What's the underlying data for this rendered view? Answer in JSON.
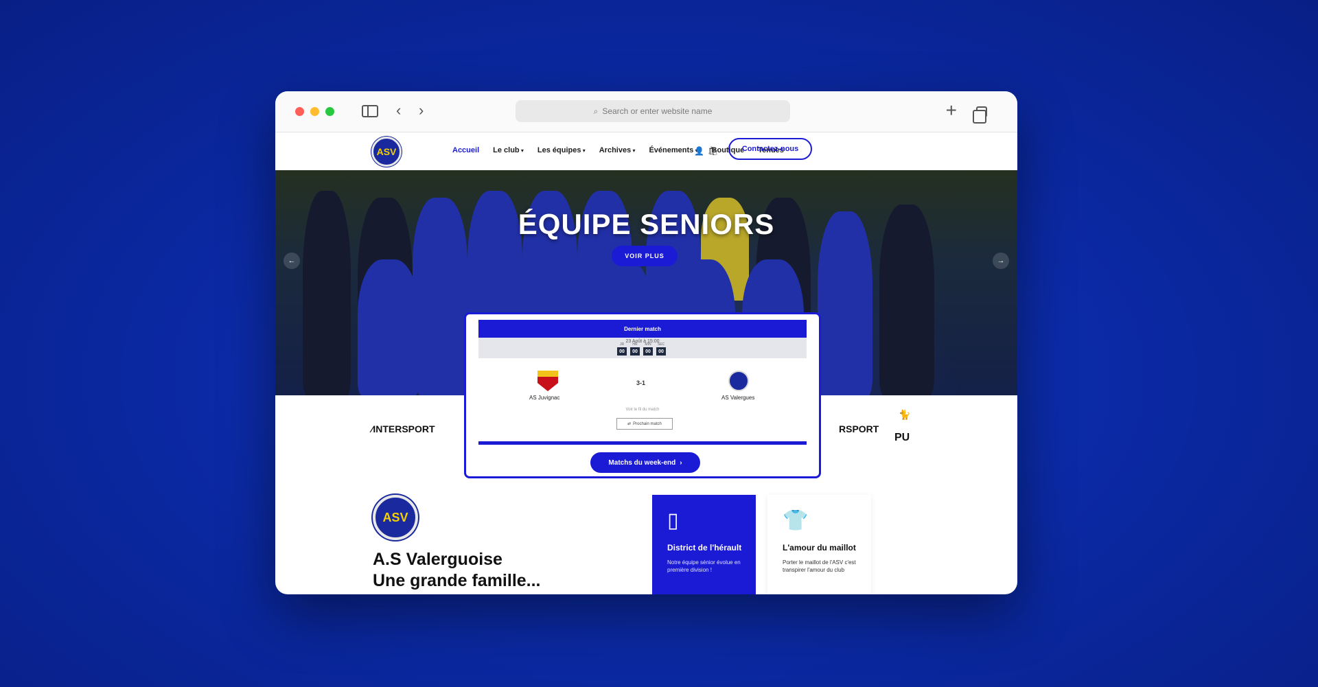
{
  "browser": {
    "url_placeholder": "Search or enter website name",
    "back_icon": "chevron-left-icon",
    "forward_icon": "chevron-right-icon"
  },
  "header": {
    "logo_text": "ASV",
    "nav": [
      {
        "label": "Accueil",
        "active": true
      },
      {
        "label": "Le club",
        "dropdown": true
      },
      {
        "label": "Les équipes",
        "dropdown": true
      },
      {
        "label": "Archives",
        "dropdown": true
      },
      {
        "label": "Événements",
        "dropdown": true
      },
      {
        "label": "Boutique"
      },
      {
        "label": "Tenues"
      }
    ],
    "contact_label": "Contactez-nous"
  },
  "hero": {
    "title": "ÉQUIPE SENIORS",
    "cta_label": "VOIR PLUS"
  },
  "match": {
    "header": "Dernier match",
    "date": "23 Août à 15:00",
    "countdown": [
      {
        "label": "JR",
        "value": "00"
      },
      {
        "label": "HR",
        "value": "00"
      },
      {
        "label": "MIN",
        "value": "00"
      },
      {
        "label": "SEC",
        "value": "00"
      }
    ],
    "home_team": "AS Juvignac",
    "away_team": "AS Valergues",
    "score": "3-1",
    "fil_link": "Voir le fil du match",
    "next_label": "Prochain match",
    "weekend_label": "Matchs du week-end"
  },
  "sponsors": {
    "left": "INTERSPORT",
    "right": "RSPORT",
    "right2": "PU"
  },
  "about": {
    "title_line1": "A.S Valerguoise",
    "title_line2": "Une grande famille..."
  },
  "features": [
    {
      "title": "District de l'hérault",
      "text": "Notre équipe sénior évolue en première division !"
    },
    {
      "title": "L'amour du maillot",
      "text": "Porter le maillot de l'ASV c'est transpirer l'amour du club"
    }
  ],
  "colors": {
    "brand_blue": "#1b1bd6",
    "background": "#0b2aa6"
  }
}
